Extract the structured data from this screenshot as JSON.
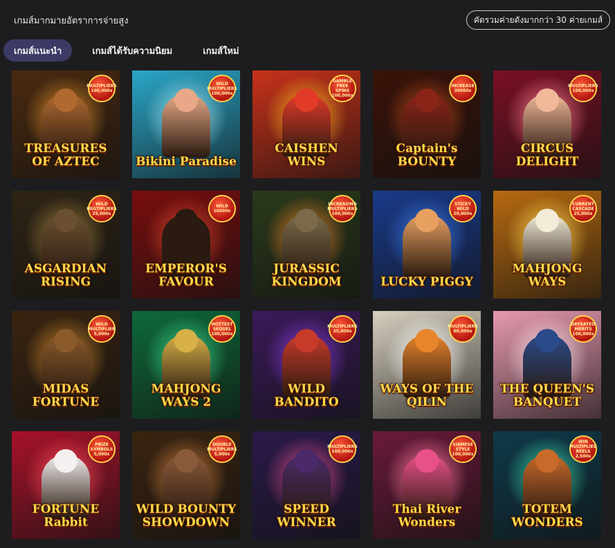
{
  "header": {
    "headline": "เกมส์มากมายอัตราการจ่ายสูง",
    "filter_button": "คัดรวมค่ายดังมากกว่า 30 ค่ายเกมส์"
  },
  "tabs": [
    {
      "label": "เกมส์แนะนำ",
      "active": true
    },
    {
      "label": "เกมส์ได้รับความนิยม",
      "active": false
    },
    {
      "label": "เกมส์ใหม่",
      "active": false
    }
  ],
  "games": [
    {
      "title": "TREASURES OF AZTEC",
      "badge": "MULTIPLIERS 100,000x",
      "bg": "#4a2a10",
      "glow": "#d88a2a",
      "figure": "#b06a30"
    },
    {
      "title": "Bikini Paradise",
      "badge": "WILD MULTIPLIERS 100,000x",
      "bg": "#2aa6c8",
      "glow": "#9fe6f2",
      "figure": "#e8a888"
    },
    {
      "title": "CAISHEN WINS",
      "badge": "GAMBLE FREE SPINS 100,000x",
      "bg": "#c8321a",
      "glow": "#ffb21e",
      "figure": "#e23a28"
    },
    {
      "title": "Captain's BOUNTY",
      "badge": "INCREASE 30000x",
      "bg": "#3a1208",
      "glow": "#b3461a",
      "figure": "#8a2418"
    },
    {
      "title": "CIRCUS DELIGHT",
      "badge": "MULTIPLIERS 100,000x",
      "bg": "#7a1024",
      "glow": "#ff7a8e",
      "figure": "#f2b89a"
    },
    {
      "title": "ASGARDIAN RISING",
      "badge": "WILD MULTIPLIERS 25,000x",
      "bg": "#2e2414",
      "glow": "#9a7a3a",
      "figure": "#6a5030"
    },
    {
      "title": "EMPEROR'S FAVOUR",
      "badge": "WILD 10000x",
      "bg": "#7a0e0e",
      "glow": "#d8442a",
      "figure": "#2a1a12"
    },
    {
      "title": "JURASSIC KINGDOM",
      "badge": "INCREASING MULTIPLIERS 100,000x",
      "bg": "#2a3a1a",
      "glow": "#e07a28",
      "figure": "#7a6a4a"
    },
    {
      "title": "LUCKY PIGGY",
      "badge": "STICKY WILD 20,000x",
      "bg": "#1a3a8a",
      "glow": "#3a7ae8",
      "figure": "#e8a060"
    },
    {
      "title": "MAHJONG WAYS",
      "badge": "CURRENT CASCADE 25,000x",
      "bg": "#b86a10",
      "glow": "#ffd24a",
      "figure": "#f2ecd8"
    },
    {
      "title": "MIDAS FORTUNE",
      "badge": "WILD MULTIPLIER 5,000x",
      "bg": "#3a2410",
      "glow": "#c8842a",
      "figure": "#8a5a2a"
    },
    {
      "title": "MAHJONG WAYS 2",
      "badge": "HOTTEST SEQUEL 100,000x",
      "bg": "#0e6a3a",
      "glow": "#3ad88a",
      "figure": "#d8b048"
    },
    {
      "title": "WILD BANDITO",
      "badge": "MULTIPLIERS 25,000x",
      "bg": "#3a1a5a",
      "glow": "#8a3ad8",
      "figure": "#c83a2a"
    },
    {
      "title": "WAYS OF THE QILIN",
      "badge": "MULTIPLIERS 80,000x",
      "bg": "#d8d0c0",
      "glow": "#ffffff",
      "figure": "#e8842a"
    },
    {
      "title": "THE QUEEN'S BANQUET",
      "badge": "DEFEATED MERITS 100,000x",
      "bg": "#e89ab0",
      "glow": "#ffe0e8",
      "figure": "#2a4a8a"
    },
    {
      "title": "FORTUNE Rabbit",
      "badge": "PRIZE SYMBOLS 5,000x",
      "bg": "#a8122a",
      "glow": "#ff4a5a",
      "figure": "#f4f0f0"
    },
    {
      "title": "WILD BOUNTY SHOWDOWN",
      "badge": "DOUBLE MULTIPLIERS 5,000x",
      "bg": "#3a2410",
      "glow": "#c87a3a",
      "figure": "#8a5a3a"
    },
    {
      "title": "SPEED WINNER",
      "badge": "MULTIPLIERS 100,000x",
      "bg": "#2a1a4a",
      "glow": "#d84a8a",
      "figure": "#4a2a6a"
    },
    {
      "title": "Thai River Wonders",
      "badge": "SIAMESE STYLE 100,000x",
      "bg": "#6a1a3a",
      "glow": "#ff7aa0",
      "figure": "#e8508a"
    },
    {
      "title": "TOTEM WONDERS",
      "badge": "WIN MULTIPLIED REELS 2,500x",
      "bg": "#0e3a4a",
      "glow": "#3ad8a8",
      "figure": "#c86a2a"
    }
  ]
}
